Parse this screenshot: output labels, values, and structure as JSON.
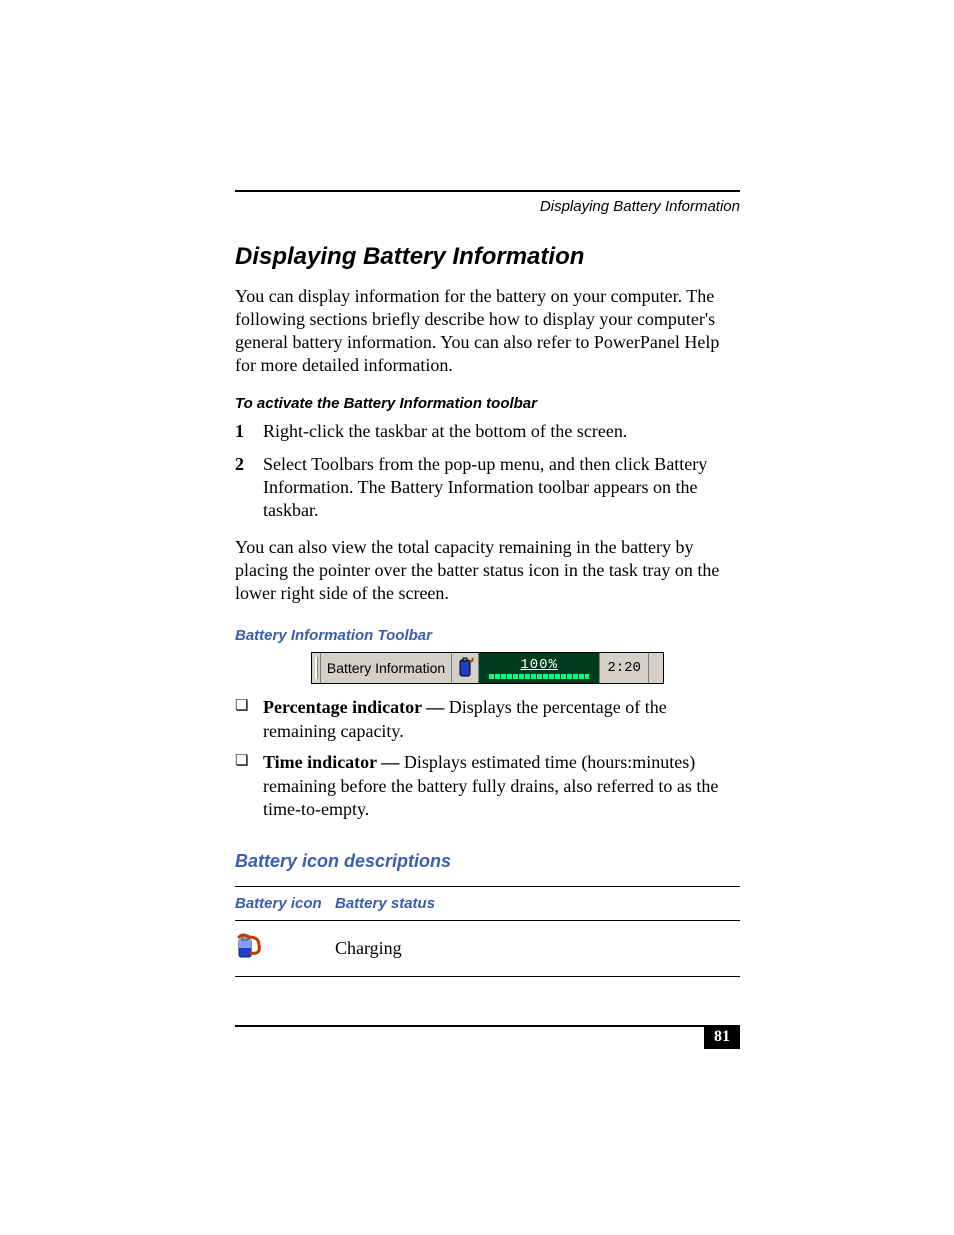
{
  "header": {
    "running_head": "Displaying Battery Information"
  },
  "title": "Displaying Battery Information",
  "intro": "You can display information for the battery on your computer. The following sections briefly describe how to display your computer's general battery information. You can also refer to PowerPanel Help for more detailed information.",
  "sub1": "To activate the Battery Information toolbar",
  "steps": [
    {
      "n": "1",
      "t": "Right-click the taskbar at the bottom of the screen."
    },
    {
      "n": "2",
      "t": "Select Toolbars from the pop-up menu, and then click Battery Information. The Battery Information toolbar appears on the taskbar."
    }
  ],
  "para2": "You can also view the total capacity remaining in the battery by placing the pointer over the batter status icon in the task tray on the lower right side of the screen.",
  "caption": "Battery Information Toolbar",
  "toolbar": {
    "label": "Battery Information",
    "percent": "100%",
    "time": "2:20"
  },
  "bullets": [
    {
      "label": "Percentage indicator — ",
      "text": "Displays the percentage of the remaining capacity."
    },
    {
      "label": "Time indicator — ",
      "text": "Displays estimated time (hours:minutes) remaining before the battery fully drains, also referred to as the time-to-empty."
    }
  ],
  "sub_blue": "Battery icon descriptions",
  "table": {
    "h1": "Battery icon",
    "h2": "Battery status",
    "rows": [
      {
        "status": "Charging"
      }
    ]
  },
  "page_number": "81"
}
